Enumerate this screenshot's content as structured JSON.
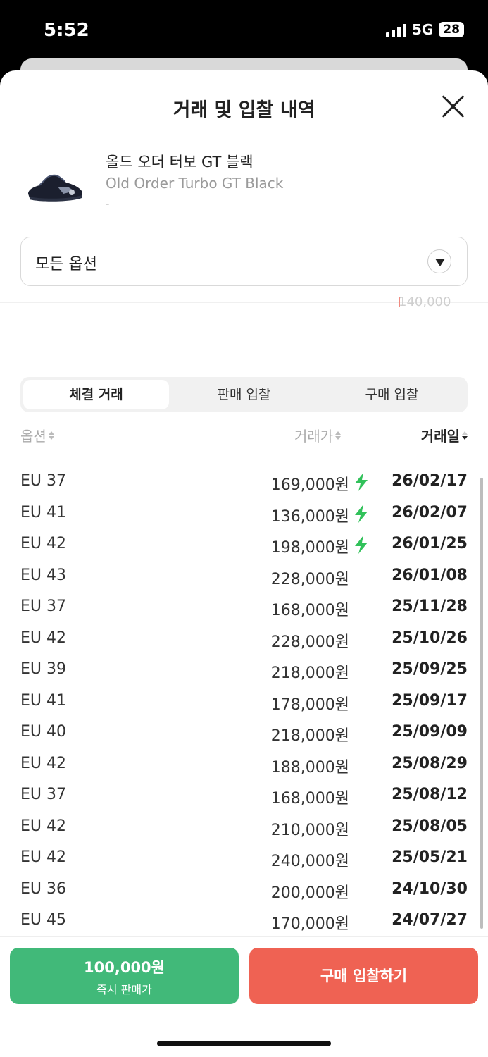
{
  "status": {
    "time": "5:52",
    "network": "5G",
    "battery": "28"
  },
  "header": {
    "title": "거래 및 입찰 내역"
  },
  "product": {
    "name_ko": "올드 오더 터보 GT 블랙",
    "name_en": "Old Order Turbo GT Black",
    "sub": "-"
  },
  "filter": {
    "selected": "모든 옵션"
  },
  "peek_value": "140,000",
  "tabs": [
    {
      "label": "체결 거래",
      "active": true
    },
    {
      "label": "판매 입찰",
      "active": false
    },
    {
      "label": "구매 입찰",
      "active": false
    }
  ],
  "columns": {
    "option": "옵션",
    "price": "거래가",
    "date": "거래일"
  },
  "rows": [
    {
      "option": "EU 37",
      "price": "169,000원",
      "quick": true,
      "date": "26/02/17"
    },
    {
      "option": "EU 41",
      "price": "136,000원",
      "quick": true,
      "date": "26/02/07"
    },
    {
      "option": "EU 42",
      "price": "198,000원",
      "quick": true,
      "date": "26/01/25"
    },
    {
      "option": "EU 43",
      "price": "228,000원",
      "quick": false,
      "date": "26/01/08"
    },
    {
      "option": "EU 37",
      "price": "168,000원",
      "quick": false,
      "date": "25/11/28"
    },
    {
      "option": "EU 42",
      "price": "228,000원",
      "quick": false,
      "date": "25/10/26"
    },
    {
      "option": "EU 39",
      "price": "218,000원",
      "quick": false,
      "date": "25/09/25"
    },
    {
      "option": "EU 41",
      "price": "178,000원",
      "quick": false,
      "date": "25/09/17"
    },
    {
      "option": "EU 40",
      "price": "218,000원",
      "quick": false,
      "date": "25/09/09"
    },
    {
      "option": "EU 42",
      "price": "188,000원",
      "quick": false,
      "date": "25/08/29"
    },
    {
      "option": "EU 37",
      "price": "168,000원",
      "quick": false,
      "date": "25/08/12"
    },
    {
      "option": "EU 42",
      "price": "210,000원",
      "quick": false,
      "date": "25/08/05"
    },
    {
      "option": "EU 42",
      "price": "240,000원",
      "quick": false,
      "date": "25/05/21"
    },
    {
      "option": "EU 36",
      "price": "200,000원",
      "quick": false,
      "date": "24/10/30"
    },
    {
      "option": "EU 45",
      "price": "170,000원",
      "quick": false,
      "date": "24/07/27"
    }
  ],
  "actions": {
    "sell_price": "100,000원",
    "sell_label": "즉시 판매가",
    "buy_label": "구매 입찰하기"
  },
  "colors": {
    "sell": "#41b979",
    "buy": "#ef6253",
    "bolt": "#31c15a"
  },
  "icons": {
    "close": "close-icon",
    "dropdown": "chevron-down-icon",
    "quick": "lightning-bolt-icon"
  }
}
